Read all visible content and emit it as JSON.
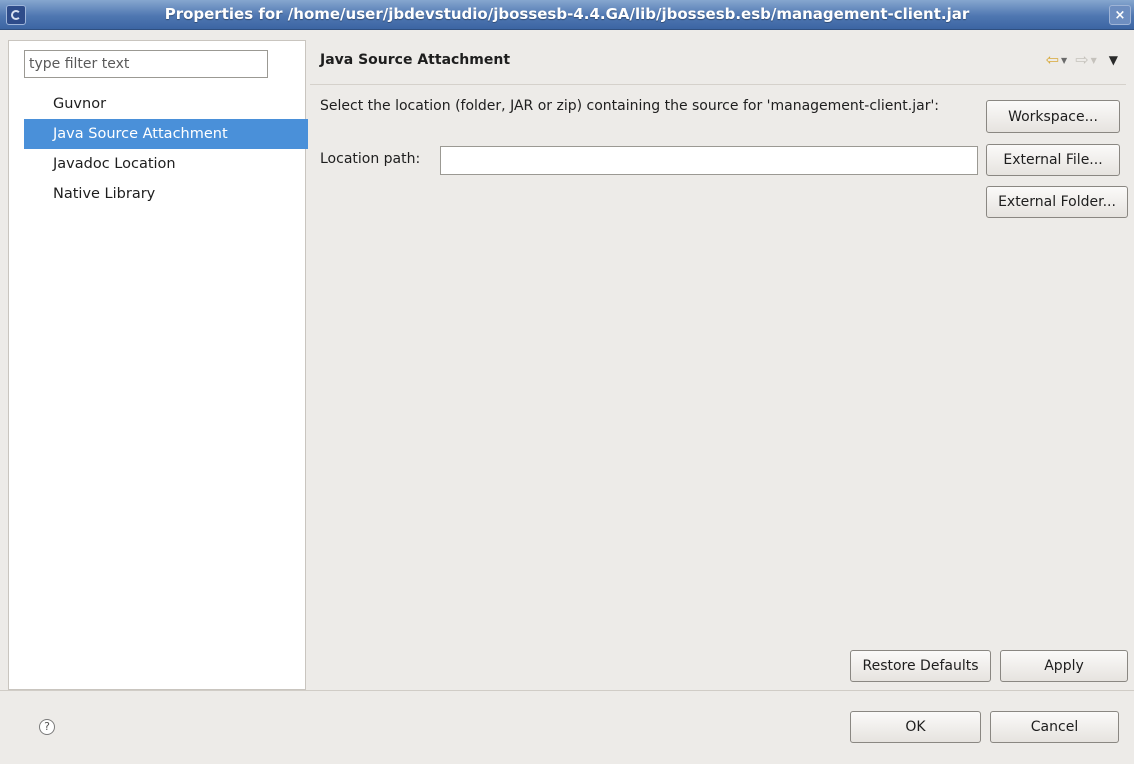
{
  "window": {
    "title": "Properties for /home/user/jbdevstudio/jbossesb-4.4.GA/lib/jbossesb.esb/management-client.jar",
    "close_label": "×"
  },
  "sidebar": {
    "filter_placeholder": "type filter text",
    "items": [
      {
        "label": "Guvnor",
        "selected": false
      },
      {
        "label": "Java Source Attachment",
        "selected": true
      },
      {
        "label": "Javadoc Location",
        "selected": false
      },
      {
        "label": "Native Library",
        "selected": false
      }
    ]
  },
  "page": {
    "title": "Java Source Attachment",
    "description": "Select the location (folder, JAR or zip) containing the source for 'management-client.jar':",
    "location_label": "Location path:",
    "location_value": ""
  },
  "buttons": {
    "workspace": "Workspace...",
    "external_file": "External File...",
    "external_folder": "External Folder...",
    "restore_defaults": "Restore Defaults",
    "apply": "Apply",
    "ok": "OK",
    "cancel": "Cancel"
  },
  "icons": {
    "app": "eclipse-icon",
    "back": "back-arrow-icon",
    "forward": "forward-arrow-icon",
    "menu": "view-menu-icon",
    "help": "help-icon"
  },
  "colors": {
    "selection": "#4a90d9",
    "titlebar": "#4f77b1",
    "dialog_bg": "#edebe8"
  }
}
